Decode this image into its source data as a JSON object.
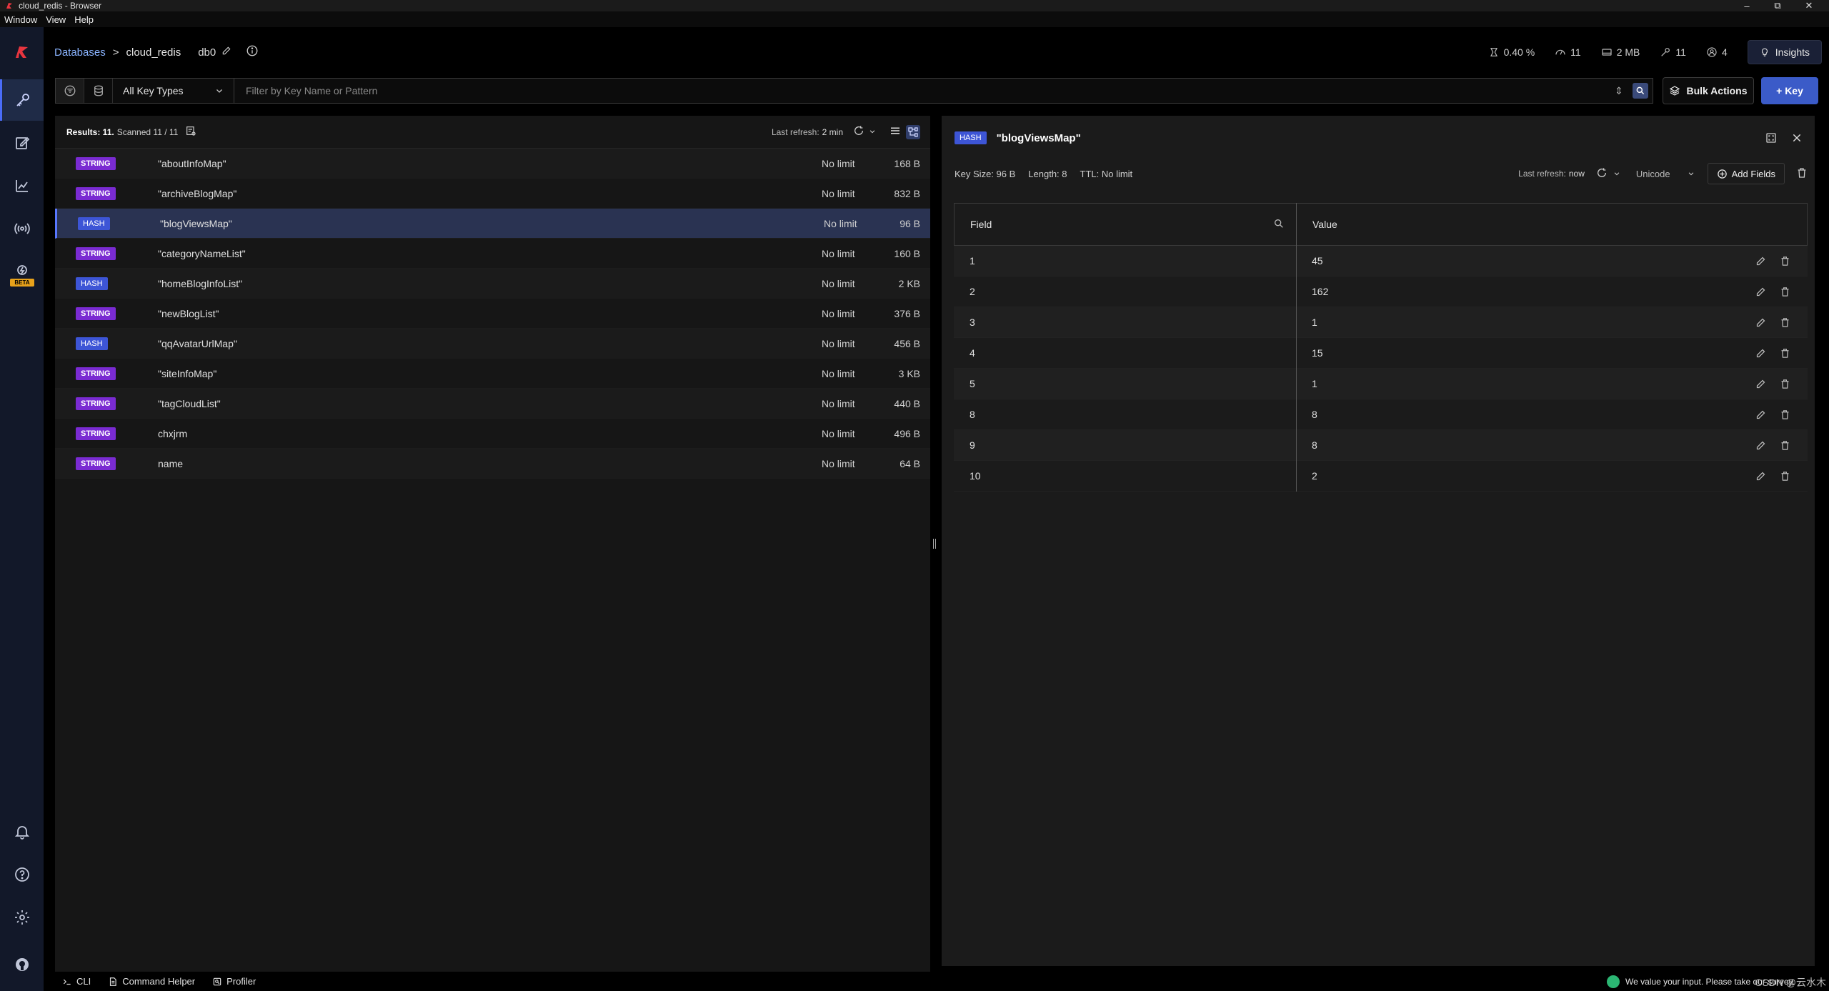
{
  "window": {
    "title": "cloud_redis - Browser",
    "menu": [
      "Window",
      "View",
      "Help"
    ]
  },
  "header": {
    "breadcrumb_databases": "Databases",
    "breadcrumb_sep": ">",
    "database_name": "cloud_redis",
    "db_index": "db0",
    "stats": {
      "cpu": "0.40 %",
      "ops": "11",
      "memory": "2 MB",
      "keys": "11",
      "clients": "4"
    },
    "insights_label": "Insights"
  },
  "filter": {
    "key_type": "All Key Types",
    "search_placeholder": "Filter by Key Name or Pattern",
    "search_value": "",
    "bulk_actions_label": "Bulk Actions",
    "add_key_label": "+ Key"
  },
  "keys_panel": {
    "results_label": "Results: 11.",
    "scanned_label": "Scanned 11 / 11",
    "last_refresh_label": "Last refresh:",
    "last_refresh_value": "2 min",
    "keys": [
      {
        "type": "STRING",
        "name": "\"aboutInfoMap\"",
        "ttl": "No limit",
        "size": "168 B"
      },
      {
        "type": "STRING",
        "name": "\"archiveBlogMap\"",
        "ttl": "No limit",
        "size": "832 B"
      },
      {
        "type": "HASH",
        "name": "\"blogViewsMap\"",
        "ttl": "No limit",
        "size": "96 B"
      },
      {
        "type": "STRING",
        "name": "\"categoryNameList\"",
        "ttl": "No limit",
        "size": "160 B"
      },
      {
        "type": "HASH",
        "name": "\"homeBlogInfoList\"",
        "ttl": "No limit",
        "size": "2 KB"
      },
      {
        "type": "STRING",
        "name": "\"newBlogList\"",
        "ttl": "No limit",
        "size": "376 B"
      },
      {
        "type": "HASH",
        "name": "\"qqAvatarUrlMap\"",
        "ttl": "No limit",
        "size": "456 B"
      },
      {
        "type": "STRING",
        "name": "\"siteInfoMap\"",
        "ttl": "No limit",
        "size": "3 KB"
      },
      {
        "type": "STRING",
        "name": "\"tagCloudList\"",
        "ttl": "No limit",
        "size": "440 B"
      },
      {
        "type": "STRING",
        "name": "chxjrm",
        "ttl": "No limit",
        "size": "496 B"
      },
      {
        "type": "STRING",
        "name": "name",
        "ttl": "No limit",
        "size": "64 B"
      }
    ]
  },
  "detail": {
    "type": "HASH",
    "key_name": "\"blogViewsMap\"",
    "key_size": "Key Size: 96 B",
    "length": "Length: 8",
    "ttl": "TTL:  No limit",
    "last_refresh_label": "Last refresh:",
    "last_refresh_value": "now",
    "encoding": "Unicode",
    "add_fields_label": "Add Fields",
    "columns": {
      "field": "Field",
      "value": "Value"
    },
    "rows": [
      {
        "field": "1",
        "value": "45"
      },
      {
        "field": "2",
        "value": "162"
      },
      {
        "field": "3",
        "value": "1"
      },
      {
        "field": "4",
        "value": "15"
      },
      {
        "field": "5",
        "value": "1"
      },
      {
        "field": "8",
        "value": "8"
      },
      {
        "field": "9",
        "value": "8"
      },
      {
        "field": "10",
        "value": "2"
      }
    ]
  },
  "bottom_bar": {
    "cli_label": "CLI",
    "command_helper_label": "Command Helper",
    "profiler_label": "Profiler",
    "survey_text": "We value your input. Please take our survey.",
    "watermark": "CSDN @云水木"
  },
  "colors": {
    "accent": "#3b5bc8",
    "string_badge": "#7a2bd2",
    "hash_badge": "#3d55d6",
    "logo": "#e8353f",
    "beta": "#e8a21b"
  }
}
